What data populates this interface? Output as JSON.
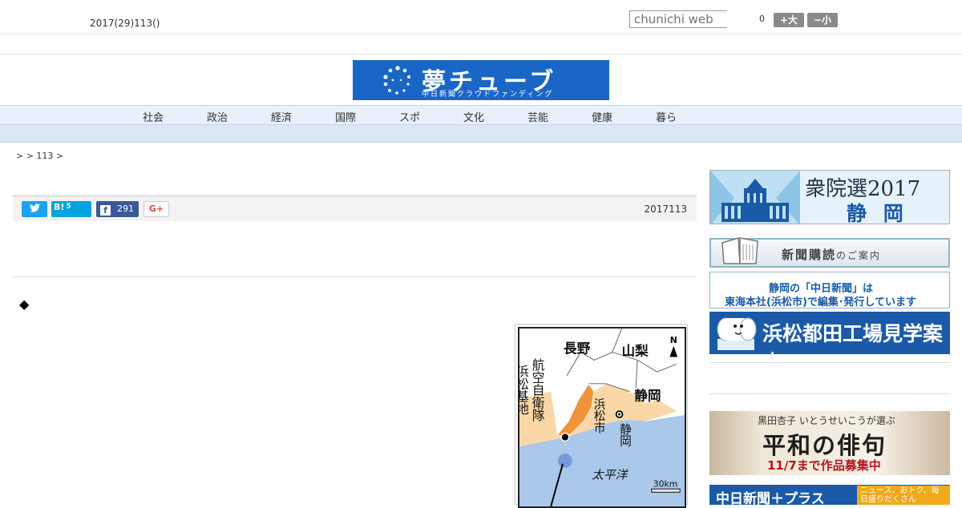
{
  "header": {
    "date": "2017(29)113()",
    "search_placeholder": "chunichi web",
    "count": "0",
    "font_larger": "+大",
    "font_smaller": "−小"
  },
  "banner": {
    "title": "夢チューブ",
    "subtitle": "中日新聞クラウドファンディング",
    "bg_color": "#1a66c7"
  },
  "nav": {
    "items": [
      "社会",
      "政治",
      "経済",
      "国際",
      "スポ",
      "文化",
      "芸能",
      "健康",
      "暮ら"
    ]
  },
  "breadcrumb": ">  > 113 >",
  "social": {
    "twitter_icon": "twitter-bird-icon",
    "hatena_label": "B!",
    "hatena_count": "5",
    "facebook_label": "f",
    "facebook_count": "291",
    "gplus_label": "G+"
  },
  "article": {
    "date": "2017113",
    "bullet": "◆"
  },
  "map": {
    "labels": {
      "nagano": "長野",
      "yamanashi": "山梨",
      "shizuoka_pref": "静岡",
      "base": "浜松基地",
      "jsdf": "航空自衛隊",
      "hamamatsu": "浜松市",
      "shizuoka_city": "静岡",
      "pacific": "太平洋",
      "scale": "30km",
      "north": "N"
    }
  },
  "sidebar": {
    "election_title": "衆院選2017",
    "election_sub": "静 岡",
    "subscribe_main": "新聞購読",
    "subscribe_suffix": "のご案内",
    "chunichi_line1": "静岡の「中日新聞」は",
    "chunichi_line2": "東海本社(浜松市)で編集･発行しています",
    "factory_tour": "浜松都田工場見学案内",
    "haiku_line1": "黒田杏子 いとうせいこうが選ぶ",
    "haiku_line2": "平和の俳句",
    "haiku_line3": "11/7まで作品募集中",
    "plus_title": "中日新聞＋プラス",
    "plus_tag": "ニュース、おトク、毎日盛りだくさん"
  }
}
